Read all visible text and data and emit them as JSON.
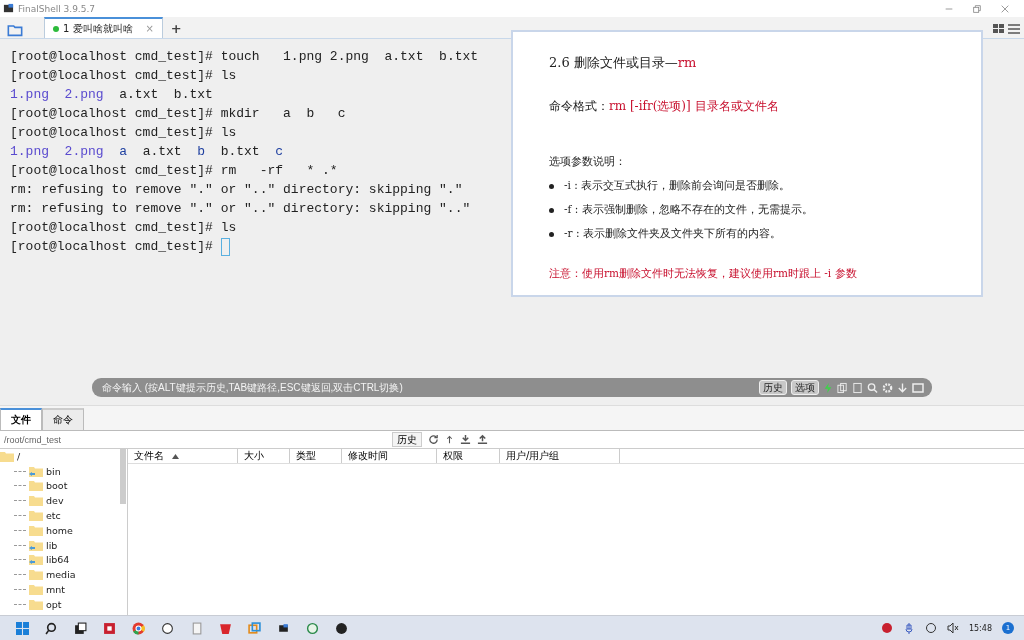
{
  "window": {
    "title": "FinalShell 3.9.5.7"
  },
  "session_tabs": [
    {
      "number": "1",
      "label": "爱叫啥就叫啥",
      "close": "×",
      "connected": true,
      "selected": true
    }
  ],
  "add_tab": "+",
  "terminal": {
    "lines": [
      [
        {
          "kind": "prompt",
          "text": "[root@localhost cmd_test]# "
        },
        {
          "kind": "plain",
          "text": "touch   1.png 2.png  a.txt  b.txt"
        }
      ],
      [
        {
          "kind": "prompt",
          "text": "[root@localhost cmd_test]# "
        },
        {
          "kind": "plain",
          "text": "ls"
        }
      ],
      [
        {
          "kind": "image",
          "text": "1.png"
        },
        {
          "kind": "image",
          "text": "  2.png"
        },
        {
          "kind": "plain",
          "text": "  a.txt  b.txt"
        }
      ],
      [
        {
          "kind": "prompt",
          "text": "[root@localhost cmd_test]# "
        },
        {
          "kind": "plain",
          "text": "mkdir   a  b   c"
        }
      ],
      [
        {
          "kind": "prompt",
          "text": "[root@localhost cmd_test]# "
        },
        {
          "kind": "plain",
          "text": "ls"
        }
      ],
      [
        {
          "kind": "image",
          "text": "1.png"
        },
        {
          "kind": "image",
          "text": "  2.png"
        },
        {
          "kind": "dir",
          "text": "  a"
        },
        {
          "kind": "plain",
          "text": "  a.txt  "
        },
        {
          "kind": "dir",
          "text": "b"
        },
        {
          "kind": "plain",
          "text": "  b.txt  "
        },
        {
          "kind": "dir",
          "text": "c"
        }
      ],
      [
        {
          "kind": "prompt",
          "text": "[root@localhost cmd_test]# "
        },
        {
          "kind": "plain",
          "text": "rm   -rf   * .*"
        }
      ],
      [
        {
          "kind": "plain",
          "text": "rm: refusing to remove \".\" or \"..\" directory: skipping \".\""
        }
      ],
      [
        {
          "kind": "plain",
          "text": "rm: refusing to remove \".\" or \"..\" directory: skipping \"..\""
        }
      ],
      [
        {
          "kind": "prompt",
          "text": "[root@localhost cmd_test]# "
        },
        {
          "kind": "plain",
          "text": "ls"
        }
      ],
      [
        {
          "kind": "prompt",
          "text": "[root@localhost cmd_test]# "
        },
        {
          "kind": "cursor"
        }
      ]
    ]
  },
  "document": {
    "heading": "2.6 删除文件或目录—",
    "heading_command": "rm",
    "format_label": "命令格式：",
    "format_value": "rm [-ifr(选项)] 目录名或文件名",
    "options_title": "选项参数说明：",
    "options": [
      {
        "flag": "-i",
        "separator": ":",
        "text": "表示交互式执行，删除前会询问是否删除。"
      },
      {
        "flag": "-f",
        "separator": ":",
        "text": "表示强制删除，忽略不存在的文件，无需提示。"
      },
      {
        "flag": "-r",
        "separator": ":",
        "text": "表示删除文件夹及文件夹下所有的内容。"
      }
    ],
    "note": "注意：使用rm删除文件时无法恢复，建议使用rm时跟上 -i 参数"
  },
  "command_bar": {
    "placeholder": "命令输入 (按ALT键提示历史,TAB键路径,ESC键返回,双击CTRL切换)",
    "buttons": [
      "历史",
      "选项"
    ]
  },
  "bottom_tabs": [
    {
      "label": "文件",
      "selected": true
    },
    {
      "label": "命令",
      "selected": false
    }
  ],
  "path_bar": {
    "value": "/root/cmd_test",
    "history_button": "历史"
  },
  "tree": [
    {
      "name": "/",
      "kind": "folder",
      "children": [
        {
          "name": "bin",
          "kind": "link"
        },
        {
          "name": "boot",
          "kind": "folder"
        },
        {
          "name": "dev",
          "kind": "folder"
        },
        {
          "name": "etc",
          "kind": "folder"
        },
        {
          "name": "home",
          "kind": "folder"
        },
        {
          "name": "lib",
          "kind": "link"
        },
        {
          "name": "lib64",
          "kind": "link"
        },
        {
          "name": "media",
          "kind": "folder"
        },
        {
          "name": "mnt",
          "kind": "folder"
        },
        {
          "name": "opt",
          "kind": "folder"
        }
      ]
    }
  ],
  "file_table": {
    "columns": [
      {
        "label": "文件名",
        "sorted": true
      },
      {
        "label": "大小",
        "sorted": false
      },
      {
        "label": "类型",
        "sorted": false
      },
      {
        "label": "修改时间",
        "sorted": false
      },
      {
        "label": "权限",
        "sorted": false
      },
      {
        "label": "用户/用户组",
        "sorted": false
      }
    ]
  },
  "taskbar": {
    "time": "15:48",
    "notification_count": "1"
  }
}
